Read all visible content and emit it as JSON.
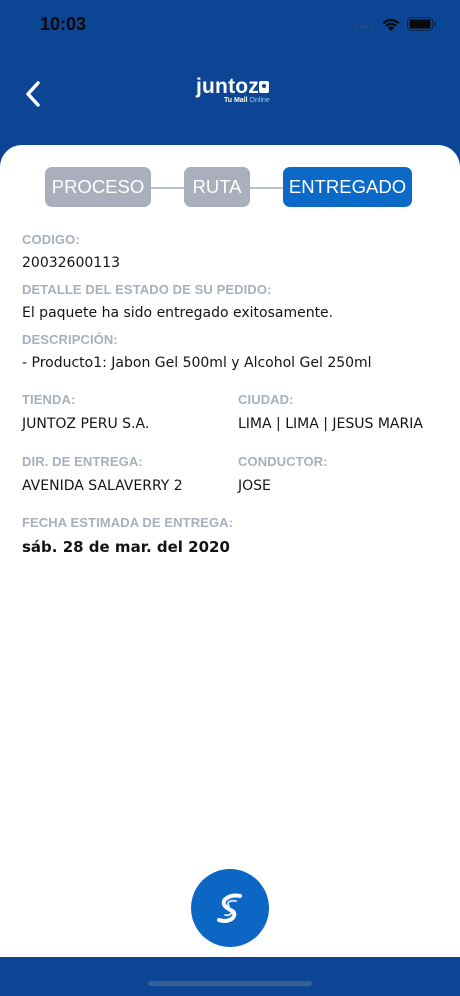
{
  "status_bar": {
    "time": "10:03"
  },
  "header": {
    "back_icon": "chevron-left-icon",
    "logo_text": "juntoz",
    "logo_tagline_bold": "Tu Mall",
    "logo_tagline_light": "Online"
  },
  "stepper": {
    "steps": [
      {
        "label": "PROCESO",
        "state": "inactive"
      },
      {
        "label": "RUTA",
        "state": "inactive"
      },
      {
        "label": "ENTREGADO",
        "state": "active"
      }
    ],
    "colors": {
      "inactive": "#a9afbd",
      "active": "#0b69c7"
    }
  },
  "details": {
    "codigo_label": "CODIGO:",
    "codigo_value": "20032600113",
    "estado_label": "DETALLE DEL ESTADO DE SU PEDIDO:",
    "estado_value": "El paquete ha sido entregado exitosamente.",
    "descripcion_label": "DESCRIPCIÓN:",
    "descripcion_value": "- Producto1: Jabon Gel 500ml y Alcohol Gel 250ml",
    "tienda_label": "TIENDA:",
    "tienda_value": "JUNTOZ PERU S.A.",
    "ciudad_label": "CIUDAD:",
    "ciudad_value": "LIMA | LIMA | JESUS MARIA",
    "direccion_label": "DIR. DE ENTREGA:",
    "direccion_value": "AVENIDA SALAVERRY 2",
    "conductor_label": "CONDUCTOR:",
    "conductor_value": "JOSE",
    "fecha_label": "FECHA ESTIMADA DE ENTREGA:",
    "fecha_value": "sáb. 28 de mar. del 2020"
  },
  "fab": {
    "icon": "courier-s-logo-icon"
  },
  "colors": {
    "brand": "#0b4593",
    "accent": "#0c67c4"
  }
}
